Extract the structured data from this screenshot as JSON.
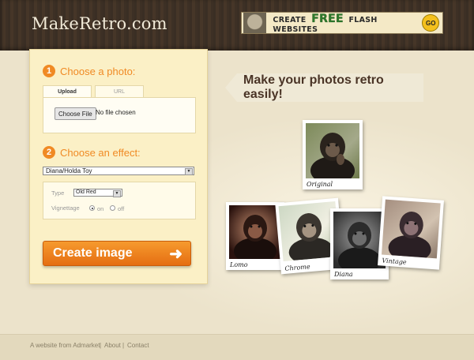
{
  "header": {
    "logo": "MakeRetro.com",
    "banner": {
      "create": "CREATE",
      "free": "FREE",
      "rest": "FLASH WEBSITES",
      "go": "GO"
    }
  },
  "steps": [
    {
      "num": "1",
      "label": "Choose a photo:"
    },
    {
      "num": "2",
      "label": "Choose an effect:"
    }
  ],
  "upload": {
    "tabs": [
      {
        "label": "Upload",
        "active": true
      },
      {
        "label": "URL",
        "active": false
      }
    ],
    "choose_button": "Choose File",
    "file_status": "No file chosen"
  },
  "effect": {
    "selected": "Diana/Holda Toy",
    "type_label": "Type",
    "type_value": "Old Red",
    "vignette_label": "Vignettage",
    "vignette_on": "on",
    "vignette_off": "off",
    "vignette_selected": "on"
  },
  "create_button": "Create image",
  "tagline": "Make your photos retro easily!",
  "samples": [
    {
      "caption": "Original"
    },
    {
      "caption": "Lomo"
    },
    {
      "caption": "Chrome"
    },
    {
      "caption": "Diana"
    },
    {
      "caption": "Vintage"
    }
  ],
  "footer": {
    "source": "A website from Admarket",
    "about": "About",
    "contact": "Contact",
    "separator": "|"
  },
  "colors": {
    "accent": "#f08a24",
    "header_bg": "#3a2e24",
    "panel_bg": "#fbf0c6",
    "tagline": "#4a3426"
  }
}
